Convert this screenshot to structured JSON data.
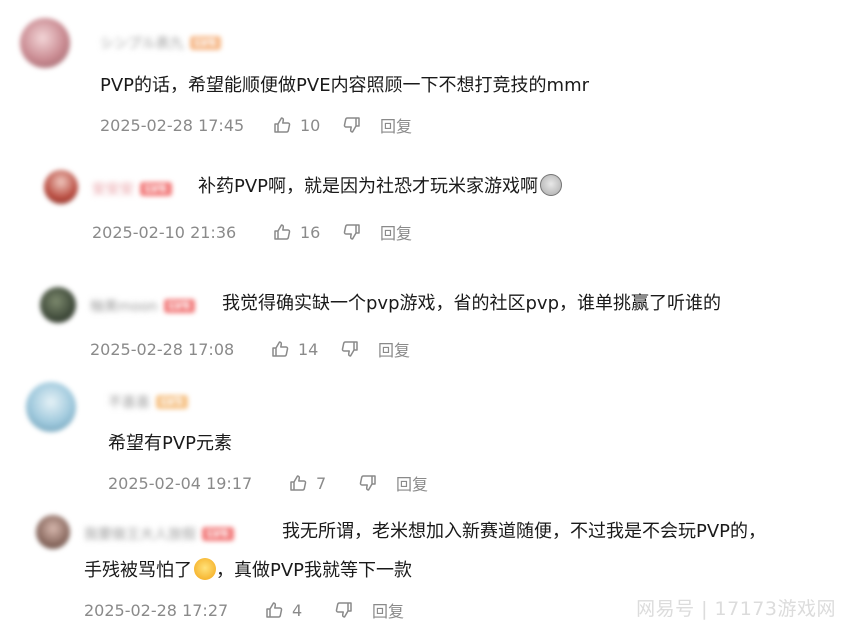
{
  "comments": [
    {
      "username": "シンプル表九",
      "level": "LV6",
      "text": "PVP的话，希望能顺便做PVE内容照顾一下不想打竞技的mmr",
      "time": "2025-02-28 17:45",
      "likes": "10",
      "reply_label": "回复",
      "avatar_color": "#c98a91",
      "level_color": "#f6b98a"
    },
    {
      "username": "安安安",
      "level": "LV6",
      "text": "补药PVP啊，就是因为社恐才玩米家游戏啊",
      "emoji": "shocked-face-emoji",
      "time": "2025-02-10 21:36",
      "likes": "16",
      "reply_label": "回复",
      "avatar_color": "#b84a3e",
      "level_color": "#f27c7c"
    },
    {
      "username": "柚美moon",
      "level": "LV6",
      "text": "我觉得确实缺一个pvp游戏，省的社区pvp，谁单挑赢了听谁的",
      "time": "2025-02-28 17:08",
      "likes": "14",
      "reply_label": "回复",
      "avatar_color": "#3f4a3a",
      "level_color": "#f27c7c"
    },
    {
      "username": "不喜喜",
      "level": "LV5",
      "text": "希望有PVP元素",
      "time": "2025-02-04 19:17",
      "likes": "7",
      "reply_label": "回复",
      "avatar_color": "#9ec8dc",
      "level_color": "#f6c48a"
    },
    {
      "username": "我要做王大人放假",
      "level": "LV6",
      "text": "我无所谓，老米想加入新赛道随便，不过我是不会玩PVP的，",
      "text2a": "手残被骂怕了",
      "emoji": "laughing-crying-emoji",
      "text2b": "，真做PVP我就等下一款",
      "time": "2025-02-28 17:27",
      "likes": "4",
      "reply_label": "回复",
      "avatar_color": "#8a6a60",
      "level_color": "#f27c7c"
    }
  ],
  "watermark": "网易号 | 17173游戏网"
}
